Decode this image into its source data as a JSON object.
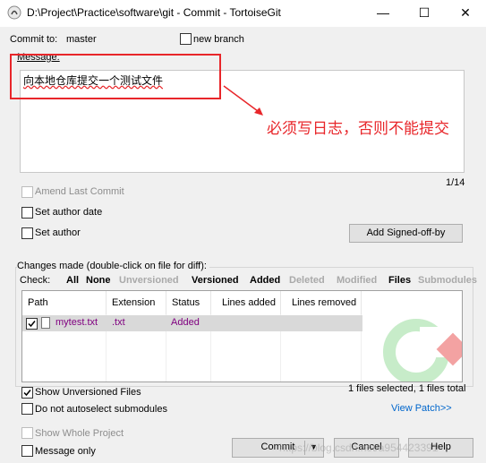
{
  "window": {
    "title": "D:\\Project\\Practice\\software\\git - Commit - TortoiseGit",
    "minimize_glyph": "—",
    "maximize_glyph": "☐",
    "close_glyph": "✕"
  },
  "commit_to": {
    "label": "Commit to:",
    "branch": "master",
    "new_branch_label": "new branch",
    "new_branch_checked": false
  },
  "message": {
    "label": "Message:",
    "text": "向本地仓库提交一个测试文件",
    "counter": "1/14"
  },
  "annotation": {
    "text": "必须写日志，否则不能提交",
    "color": "#e8262a"
  },
  "options": {
    "amend_last_commit": "Amend Last Commit",
    "set_author_date": "Set author date",
    "set_author": "Set author",
    "add_signed_off_by": "Add Signed-off-by"
  },
  "changes": {
    "group_label": "Changes made (double-click on file for diff):",
    "check_label": "Check:",
    "filters": {
      "all": "All",
      "none": "None",
      "unversioned": "Unversioned",
      "versioned": "Versioned",
      "added": "Added",
      "deleted": "Deleted",
      "modified": "Modified",
      "files": "Files",
      "submodules": "Submodules"
    },
    "columns": {
      "path": "Path",
      "extension": "Extension",
      "status": "Status",
      "lines_added": "Lines added",
      "lines_removed": "Lines removed"
    },
    "files": [
      {
        "path": "mytest.txt",
        "extension": ".txt",
        "status": "Added",
        "checked": true
      }
    ],
    "show_unversioned": "Show Unversioned Files",
    "do_not_autoselect": "Do not autoselect submodules",
    "selection_summary": "1 files selected, 1 files total",
    "view_patch": "View Patch>>"
  },
  "bottom": {
    "show_whole_project": "Show Whole Project",
    "message_only": "Message only",
    "commit_button": "Commit",
    "cancel_button": "Cancel",
    "help_button": "Help",
    "watermark": "https://blog.csdn.net/a954423391"
  },
  "colors": {
    "purple_status": "#800080",
    "link_blue": "#0066cc",
    "annotation_red": "#e8262a"
  }
}
